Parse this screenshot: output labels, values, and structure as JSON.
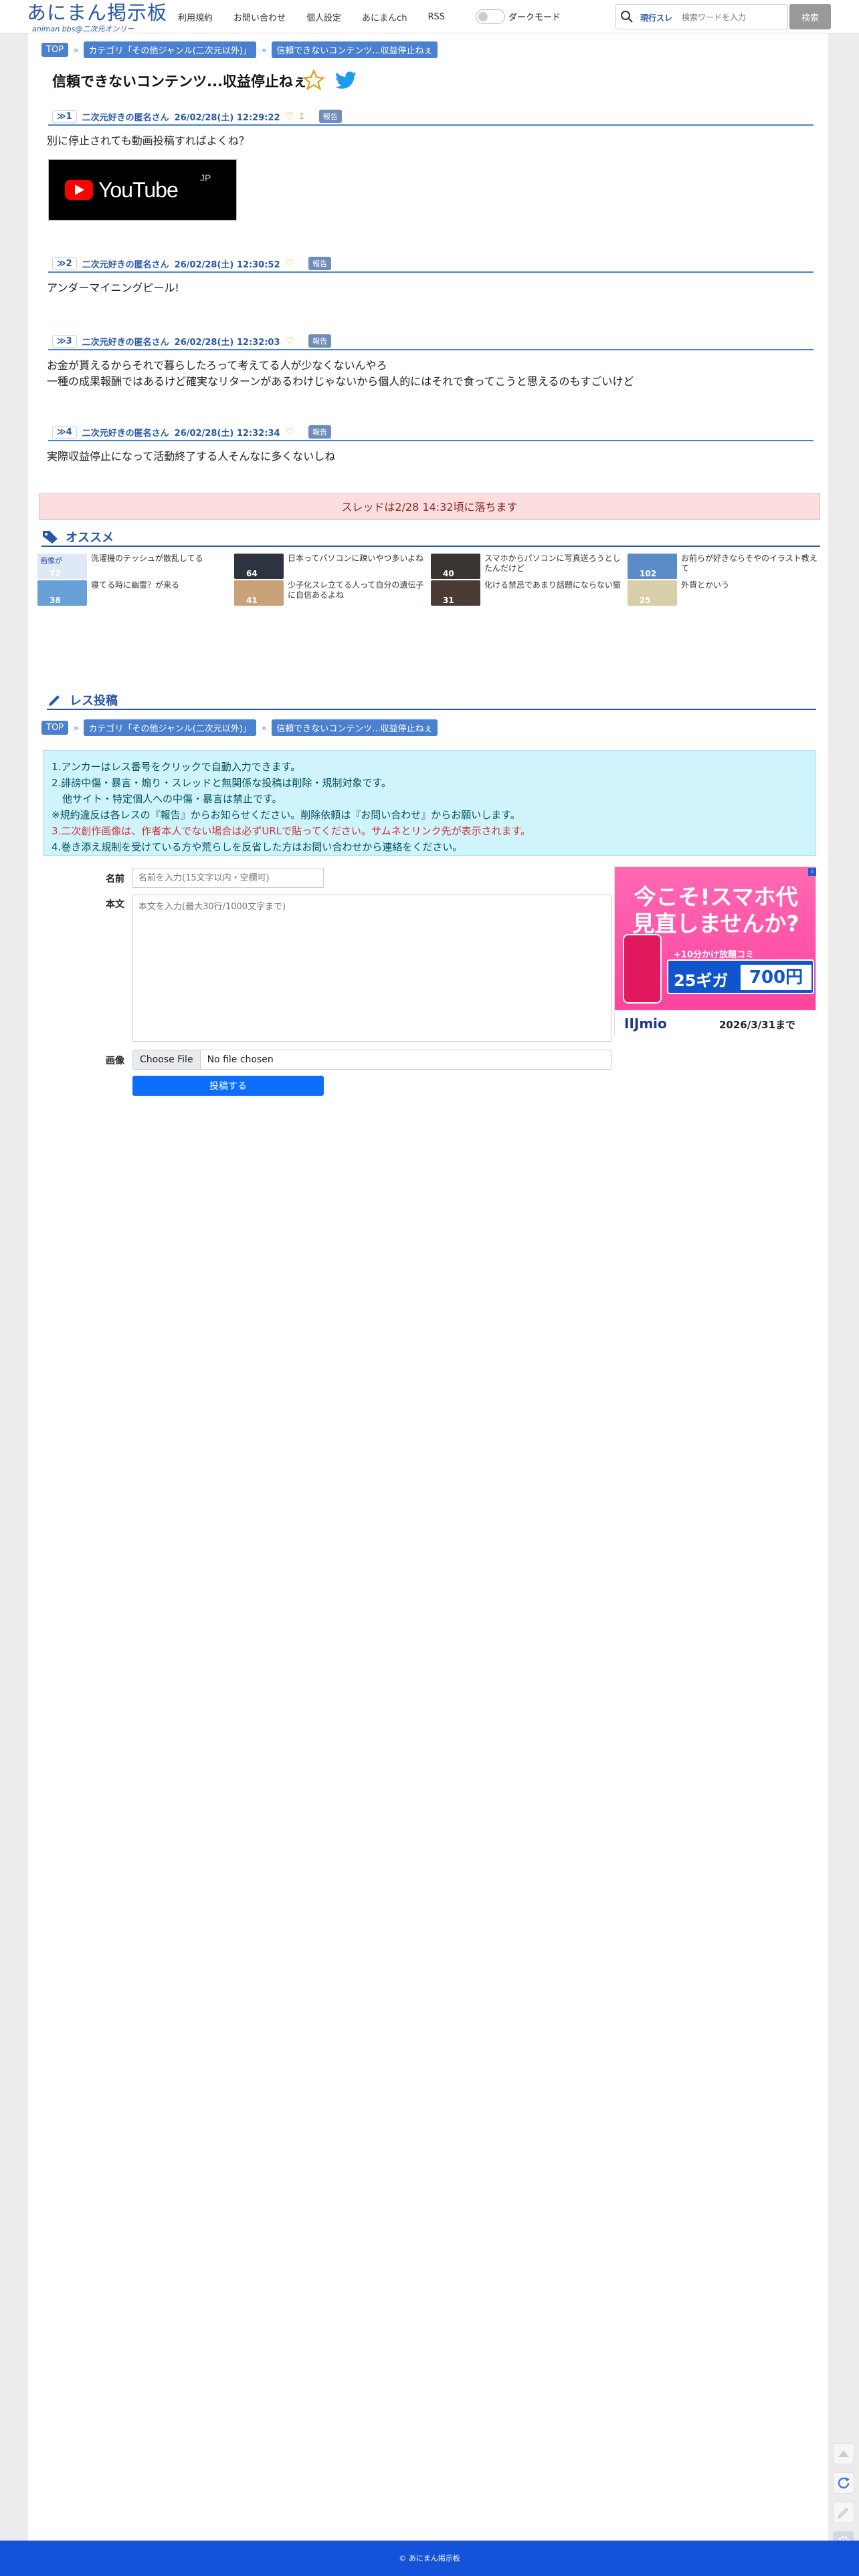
{
  "header": {
    "logo_main": "あにまん掲示板",
    "logo_sub": "animan bbs@二次元オンリー",
    "nav": [
      "利用規約",
      "お問い合わせ",
      "個人設定",
      "あにまんch",
      "RSS"
    ],
    "dark_mode_label": "ダークモード",
    "search_scope": "現行スレ",
    "search_placeholder": "検索ワードを入力",
    "search_button": "検索"
  },
  "breadcrumb": {
    "top": "TOP",
    "category": "カテゴリ「その他ジャンル(二次元以外)」",
    "thread": "信頼できないコンテンツ...収益停止ねぇ"
  },
  "thread_title": "信頼できないコンテンツ...収益停止ねぇ",
  "posts": [
    {
      "num": "≫1",
      "name": "二次元好きの匿名さん",
      "date": "26/02/28(土) 12:29:22",
      "likes": "1",
      "report": "報告",
      "text": "別に停止されても動画投稿すればよくね？",
      "image_brand": "YouTube",
      "image_region": "JP"
    },
    {
      "num": "≫2",
      "name": "二次元好きの匿名さん",
      "date": "26/02/28(土) 12:30:52",
      "likes": "",
      "report": "報告",
      "text": "アンダーマイニングピール!"
    },
    {
      "num": "≫3",
      "name": "二次元好きの匿名さん",
      "date": "26/02/28(土) 12:32:03",
      "likes": "",
      "report": "報告",
      "text": "お金が貰えるからそれで暮らしたろって考えてる人が少なくないんやろ",
      "text2": "一種の成果報酬ではあるけど確実なリターンがあるわけじゃないから個人的にはそれで食ってこうと思えるのもすごいけど"
    },
    {
      "num": "≫4",
      "name": "二次元好きの匿名さん",
      "date": "26/02/28(土) 12:32:34",
      "likes": "",
      "report": "報告",
      "text": "実際収益停止になって活動終了する人そんなに多くないしね"
    }
  ],
  "notice": "スレッドは2/28 14:32頃に落ちます",
  "recommend": {
    "title": "オススメ",
    "items": [
      {
        "text": "洗濯機のテッシュが散乱してる",
        "count": "72",
        "thumb_label": "画像が"
      },
      {
        "text": "日本ってパソコンに疎いやつ多いよね",
        "count": "64"
      },
      {
        "text": "スマホからパソコンに写真送ろうとしたんだけど",
        "count": "40"
      },
      {
        "text": "お前らが好きならそやのイラスト教えて",
        "count": "102"
      },
      {
        "text": "寝てる時に幽霊？が来る",
        "count": "38"
      },
      {
        "text": "少子化スレ立てる人って自分の遺伝子に自信あるよね",
        "count": "41"
      },
      {
        "text": "化ける禁忌であまり話題にならない猫",
        "count": "31"
      },
      {
        "text": "外貨とかいう",
        "count": "25"
      }
    ]
  },
  "post_form": {
    "title": "レス投稿",
    "rules": [
      "1.アンカーはレス番号をクリックで自動入力できます。",
      "2.誹謗中傷・暴言・煽り・スレッドと無関係な投稿は削除・規制対象です。",
      "他サイト・特定個人への中傷・暴言は禁止です。",
      "※規約違反は各レスの『報告』からお知らせください。削除依頼は『お問い合わせ』からお願いします。",
      "3.二次創作画像は、作者本人でない場合は必ずURLで貼ってください。サムネとリンク先が表示されます。",
      "4.巻き添え規制を受けている方や荒らしを反省した方はお問い合わせから連絡をください。"
    ],
    "name_label": "名前",
    "name_placeholder": "名前を入力(15文字以内・空欄可)",
    "body_label": "本文",
    "body_placeholder": "本文を入力(最大30行/1000文字まで)",
    "image_label": "画像",
    "file_button": "Choose File",
    "file_status": "No file chosen",
    "submit": "投稿する"
  },
  "ad": {
    "headline1": "今こそ!スマホ代",
    "headline2": "見直しませんか?",
    "offer": "+10分かけ放題コミ",
    "data": "25ギガ",
    "price": "700円",
    "brand": "IIJmio",
    "date": "2026/3/31まで"
  },
  "footer": "© あにまん掲示板",
  "colors": {
    "accent": "#2757a8",
    "crumb": "#4a80cf",
    "footer": "#1452d9"
  }
}
